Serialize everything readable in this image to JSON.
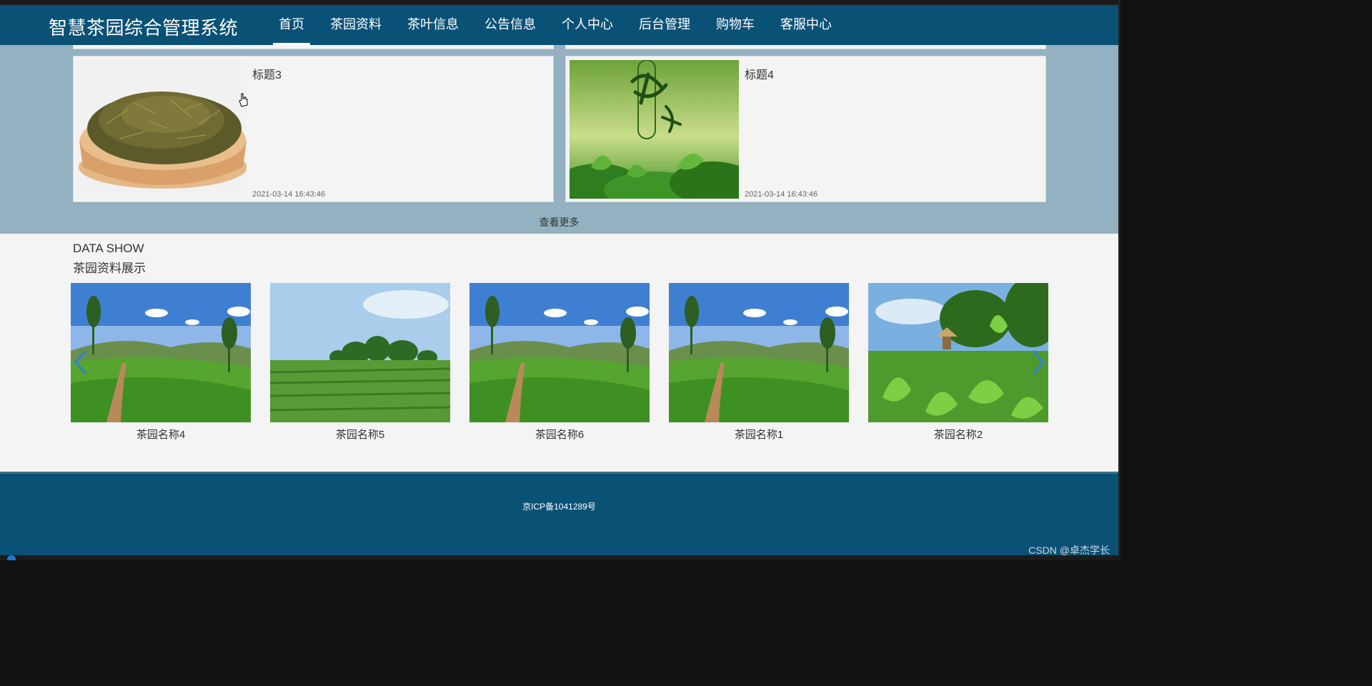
{
  "header": {
    "site_title": "智慧茶园综合管理系统",
    "nav": [
      "首页",
      "茶园资料",
      "茶叶信息",
      "公告信息",
      "个人中心",
      "后台管理",
      "购物车",
      "客服中心"
    ],
    "active_index": 0
  },
  "news": {
    "items": [
      {
        "title": "标题3",
        "time": "2021-03-14 16:43:46"
      },
      {
        "title": "标题4",
        "time": "2021-03-14 16:43:46"
      }
    ],
    "more_label": "查看更多"
  },
  "show": {
    "title_en": "DATA SHOW",
    "title_cn": "茶园资料展示",
    "items": [
      {
        "name": "茶园名称4"
      },
      {
        "name": "茶园名称5"
      },
      {
        "name": "茶园名称6"
      },
      {
        "name": "茶园名称1"
      },
      {
        "name": "茶园名称2"
      }
    ],
    "prev_icon": "chevron-left-icon",
    "next_icon": "chevron-right-icon"
  },
  "footer": {
    "icp": "京ICP备1041289号",
    "watermark": "CSDN @卓杰学长"
  },
  "colors": {
    "header": "#0a5176",
    "news_bg": "#93b1c0",
    "card_bg": "#f4f4f4"
  }
}
